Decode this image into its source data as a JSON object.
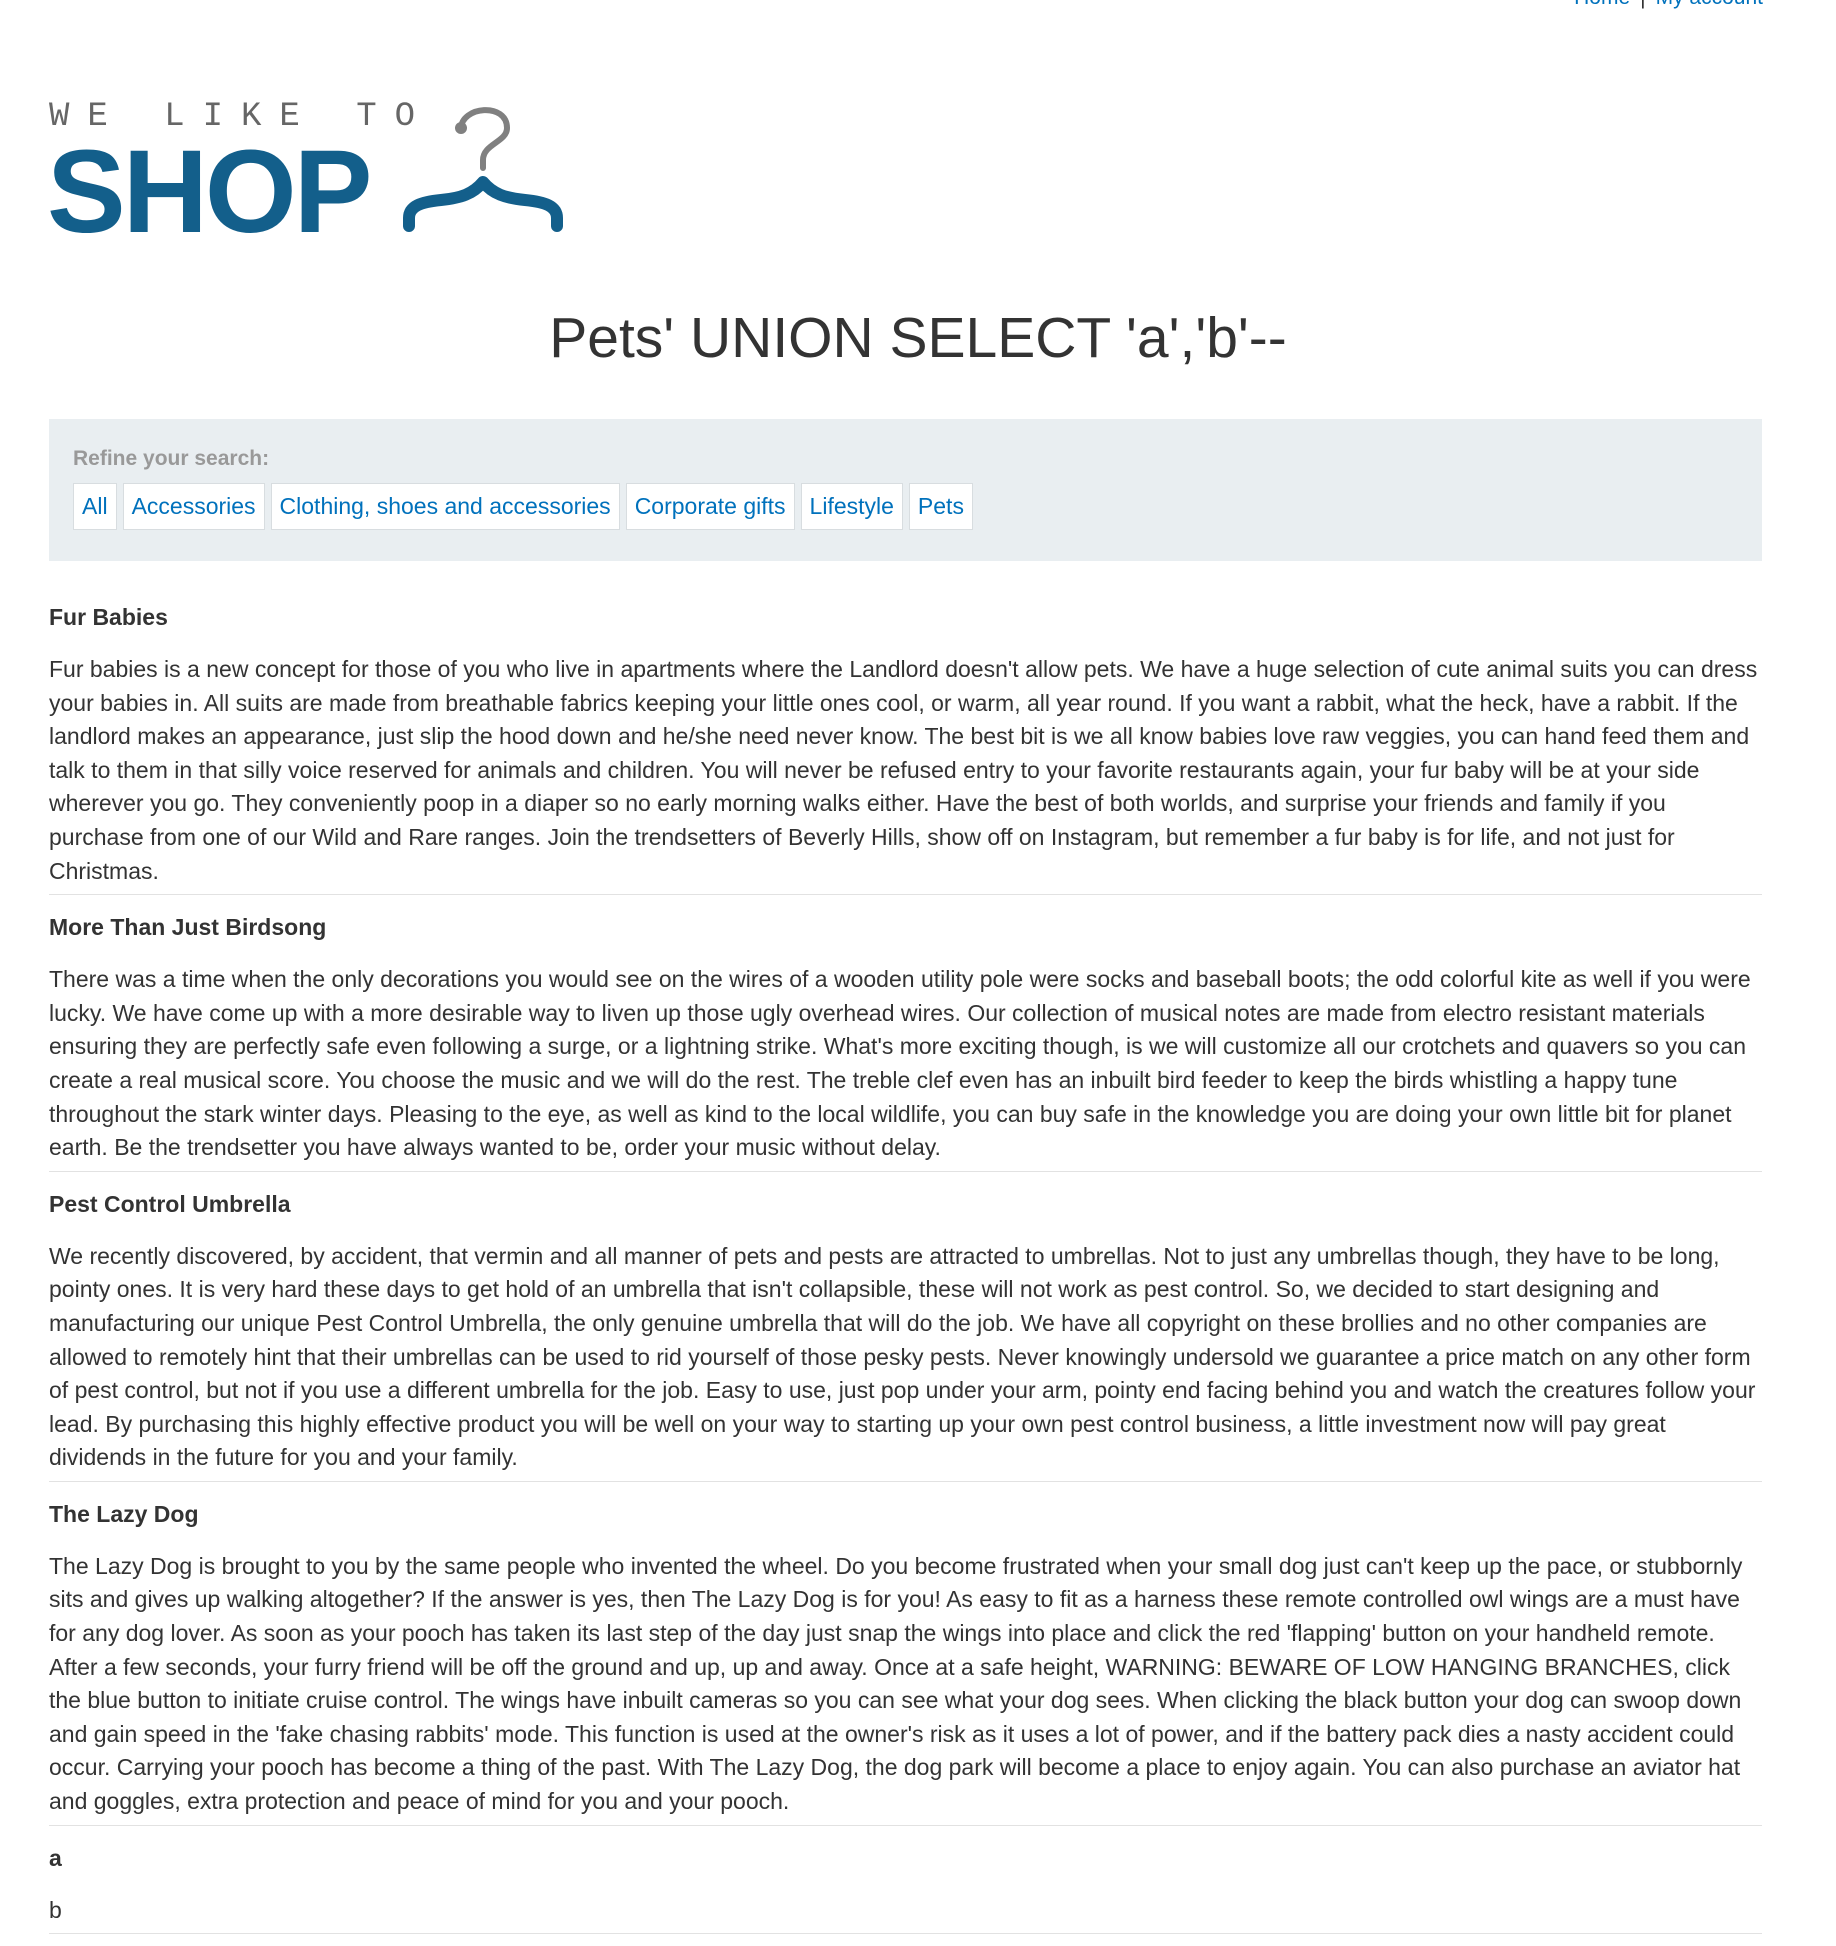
{
  "nav": {
    "home": "Home",
    "separator": "|",
    "account": "My account"
  },
  "logo": {
    "tagline": "WE LIKE TO",
    "wordmark": "SHOP",
    "icon": "hanger-icon",
    "color": "#135f8b"
  },
  "page_title": "Pets' UNION SELECT 'a','b'--",
  "filters": {
    "label": "Refine your search:",
    "items": [
      "All",
      "Accessories",
      "Clothing, shoes and accessories",
      "Corporate gifts",
      "Lifestyle",
      "Pets"
    ]
  },
  "results": [
    {
      "title": "Fur Babies",
      "body": "Fur babies is a new concept for those of you who live in apartments where the Landlord doesn't allow pets. We have a huge selection of cute animal suits you can dress your babies in. All suits are made from breathable fabrics keeping your little ones cool, or warm, all year round. If you want a rabbit, what the heck, have a rabbit. If the landlord makes an appearance, just slip the hood down and he/she need never know. The best bit is we all know babies love raw veggies, you can hand feed them and talk to them in that silly voice reserved for animals and children. You will never be refused entry to your favorite restaurants again, your fur baby will be at your side wherever you go. They conveniently poop in a diaper so no early morning walks either. Have the best of both worlds, and surprise your friends and family if you purchase from one of our Wild and Rare ranges. Join the trendsetters of Beverly Hills, show off on Instagram, but remember a fur baby is for life, and not just for Christmas."
    },
    {
      "title": "More Than Just Birdsong",
      "body": "There was a time when the only decorations you would see on the wires of a wooden utility pole were socks and baseball boots; the odd colorful kite as well if you were lucky. We have come up with a more desirable way to liven up those ugly overhead wires. Our collection of musical notes are made from electro resistant materials ensuring they are perfectly safe even following a surge, or a lightning strike. What's more exciting though, is we will customize all our crotchets and quavers so you can create a real musical score. You choose the music and we will do the rest. The treble clef even has an inbuilt bird feeder to keep the birds whistling a happy tune throughout the stark winter days. Pleasing to the eye, as well as kind to the local wildlife, you can buy safe in the knowledge you are doing your own little bit for planet earth. Be the trendsetter you have always wanted to be, order your music without delay."
    },
    {
      "title": "Pest Control Umbrella",
      "body": "We recently discovered, by accident, that vermin and all manner of pets and pests are attracted to umbrellas. Not to just any umbrellas though, they have to be long, pointy ones. It is very hard these days to get hold of an umbrella that isn't collapsible, these will not work as pest control. So, we decided to start designing and manufacturing our unique Pest Control Umbrella, the only genuine umbrella that will do the job. We have all copyright on these brollies and no other companies are allowed to remotely hint that their umbrellas can be used to rid yourself of those pesky pests. Never knowingly undersold we guarantee a price match on any other form of pest control, but not if you use a different umbrella for the job. Easy to use, just pop under your arm, pointy end facing behind you and watch the creatures follow your lead. By purchasing this highly effective product you will be well on your way to starting up your own pest control business, a little investment now will pay great dividends in the future for you and your family."
    },
    {
      "title": "The Lazy Dog",
      "body": "The Lazy Dog is brought to you by the same people who invented the wheel. Do you become frustrated when your small dog just can't keep up the pace, or stubbornly sits and gives up walking altogether? If the answer is yes, then The Lazy Dog is for you! As easy to fit as a harness these remote controlled owl wings are a must have for any dog lover. As soon as your pooch has taken its last step of the day just snap the wings into place and click the red 'flapping' button on your handheld remote. After a few seconds, your furry friend will be off the ground and up, up and away. Once at a safe height, WARNING: BEWARE OF LOW HANGING BRANCHES, click the blue button to initiate cruise control. The wings have inbuilt cameras so you can see what your dog sees. When clicking the black button your dog can swoop down and gain speed in the 'fake chasing rabbits' mode. This function is used at the owner's risk as it uses a lot of power, and if the battery pack dies a nasty accident could occur. Carrying your pooch has become a thing of the past. With The Lazy Dog, the dog park will become a place to enjoy again. You can also purchase an aviator hat and goggles, extra protection and peace of mind for you and your pooch."
    },
    {
      "title": "a",
      "body": "b"
    }
  ]
}
